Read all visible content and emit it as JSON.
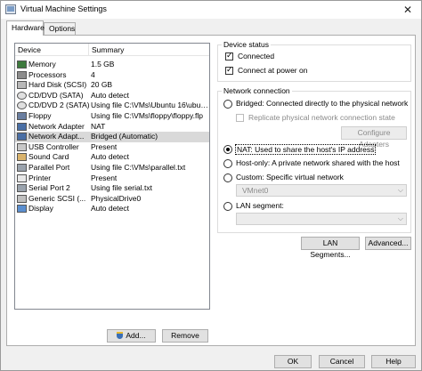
{
  "window": {
    "title": "Virtual Machine Settings",
    "close_glyph": "✕"
  },
  "tabs": [
    {
      "label": "Hardware"
    },
    {
      "label": "Options"
    }
  ],
  "device_list": {
    "headers": {
      "device": "Device",
      "summary": "Summary"
    },
    "rows": [
      {
        "device": "Memory",
        "summary": "1.5 GB",
        "icon": "memory-icon"
      },
      {
        "device": "Processors",
        "summary": "4",
        "icon": "processor-icon"
      },
      {
        "device": "Hard Disk (SCSI)",
        "summary": "20 GB",
        "icon": "hard-disk-icon"
      },
      {
        "device": "CD/DVD (SATA)",
        "summary": "Auto detect",
        "icon": "cd-dvd-icon"
      },
      {
        "device": "CD/DVD 2 (SATA)",
        "summary": "Using file C:\\VMs\\Ubuntu 16\\ubun...",
        "icon": "cd-dvd-icon"
      },
      {
        "device": "Floppy",
        "summary": "Using file C:\\VMs\\floppy\\floppy.flp",
        "icon": "floppy-icon"
      },
      {
        "device": "Network Adapter",
        "summary": "NAT",
        "icon": "network-adapter-icon"
      },
      {
        "device": "Network Adapt...",
        "summary": "Bridged (Automatic)",
        "icon": "network-adapter-icon"
      },
      {
        "device": "USB Controller",
        "summary": "Present",
        "icon": "usb-icon"
      },
      {
        "device": "Sound Card",
        "summary": "Auto detect",
        "icon": "sound-card-icon"
      },
      {
        "device": "Parallel Port",
        "summary": "Using file C:\\VMs\\parallel.txt",
        "icon": "parallel-port-icon"
      },
      {
        "device": "Printer",
        "summary": "Present",
        "icon": "printer-icon"
      },
      {
        "device": "Serial Port 2",
        "summary": "Using file serial.txt",
        "icon": "serial-port-icon"
      },
      {
        "device": "Generic SCSI (...",
        "summary": "PhysicalDrive0",
        "icon": "scsi-icon"
      },
      {
        "device": "Display",
        "summary": "Auto detect",
        "icon": "display-icon"
      }
    ],
    "selected_index": 7
  },
  "buttons": {
    "add": "Add...",
    "remove": "Remove",
    "lan_segments": "LAN Segments...",
    "advanced": "Advanced...",
    "ok": "OK",
    "cancel": "Cancel",
    "help": "Help"
  },
  "device_status": {
    "title": "Device status",
    "connected": {
      "label": "Connected",
      "checked": true
    },
    "connect_at_power_on": {
      "label": "Connect at power on",
      "checked": true
    }
  },
  "network_connection": {
    "title": "Network connection",
    "bridged": {
      "label": "Bridged: Connected directly to the physical network",
      "selected": false
    },
    "replicate": {
      "label": "Replicate physical network connection state",
      "checked": false
    },
    "configure_adapters": "Configure Adapters",
    "nat": {
      "label": "NAT: Used to share the host's IP address",
      "selected": true
    },
    "host_only": {
      "label": "Host-only: A private network shared with the host",
      "selected": false
    },
    "custom": {
      "label": "Custom: Specific virtual network",
      "selected": false
    },
    "custom_value": "VMnet0",
    "lan_segment": {
      "label": "LAN segment:",
      "selected": false
    },
    "lan_segment_value": ""
  },
  "colors": {
    "selected_row": "#d9d9d9",
    "disabled_text": "#8a8a8a"
  }
}
